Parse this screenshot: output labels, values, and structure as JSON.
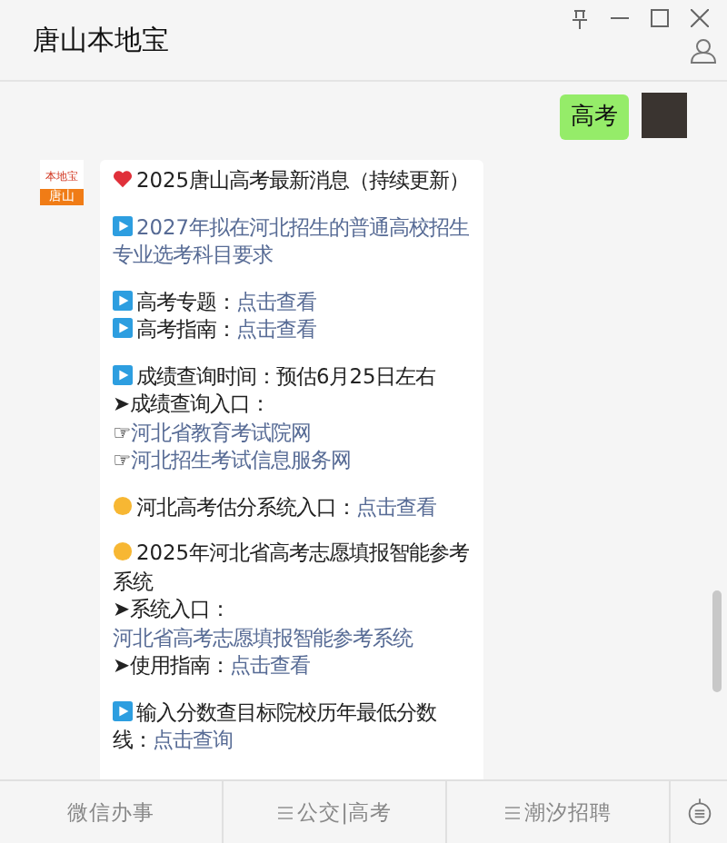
{
  "window": {
    "title": "唐山本地宝"
  },
  "messages": [
    {
      "kind": "user",
      "text": "高考"
    },
    {
      "kind": "bot",
      "logo": {
        "top": "本地宝",
        "bottom": "唐山"
      },
      "paragraphs": [
        [
          {
            "kind": "heart",
            "text": "2025唐山高考最新消息（持续更新）"
          }
        ],
        [
          {
            "kind": "play",
            "link": "2027年拟在河北招生的普通高校招生专业选考科目要求"
          }
        ],
        [
          {
            "kind": "play",
            "text": "高考专题：",
            "link": "点击查看"
          },
          {
            "kind": "play",
            "text": "高考指南：",
            "link": "点击查看"
          }
        ],
        [
          {
            "kind": "play",
            "text": "成绩查询时间：预估6月25日左右"
          },
          {
            "kind": "plain",
            "text": "➤成绩查询入口："
          },
          {
            "kind": "plain",
            "text": "☞",
            "link": "河北省教育考试院网"
          },
          {
            "kind": "plain",
            "text": "☞",
            "link": "河北招生考试信息服务网"
          }
        ],
        [
          {
            "kind": "coin",
            "text": "河北高考估分系统入口：",
            "link": "点击查看"
          }
        ],
        [
          {
            "kind": "coin",
            "text": "2025年河北省高考志愿填报智能参考系统"
          },
          {
            "kind": "plain",
            "text": "➤系统入口：",
            "link": "河北省高考志愿填报智能参考系统"
          },
          {
            "kind": "plain",
            "text": "➤使用指南：",
            "link": "点击查看"
          }
        ],
        [
          {
            "kind": "play",
            "text": "输入分数查目标院校历年最低分数线：",
            "link": "点击查询"
          }
        ]
      ]
    }
  ],
  "menu": [
    {
      "kind": "plain",
      "label": "微信办事"
    },
    {
      "kind": "submenu",
      "label": "公交|高考"
    },
    {
      "kind": "submenu",
      "label": "潮汐招聘"
    }
  ]
}
